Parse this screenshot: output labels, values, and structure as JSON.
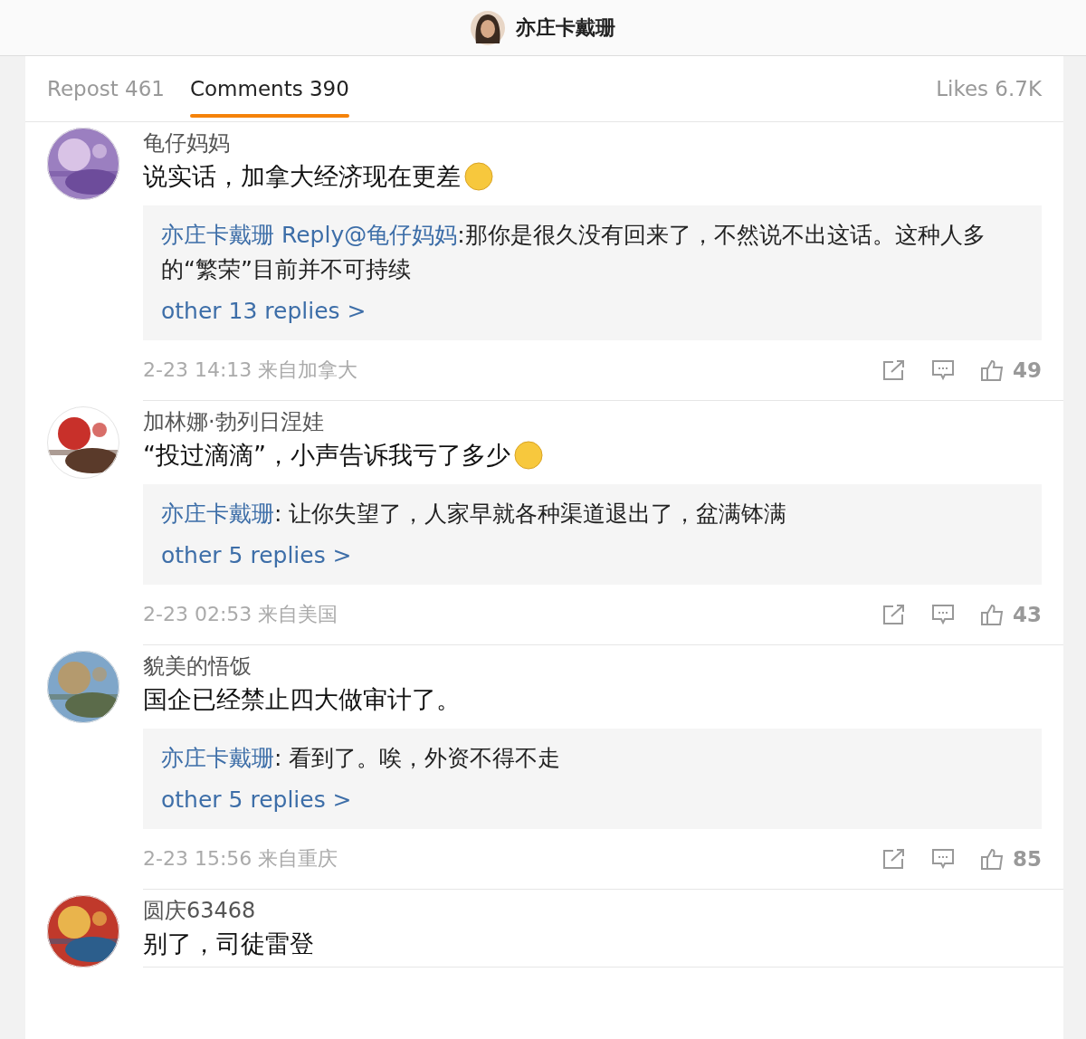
{
  "header": {
    "title": "亦庄卡戴珊"
  },
  "tabs": [
    {
      "label": "Repost 461",
      "selected": false
    },
    {
      "label": "Comments 390",
      "selected": true
    },
    {
      "label": "Likes 6.7K",
      "selected": false
    }
  ],
  "comments": [
    {
      "user": "龟仔妈妈",
      "text": "说实话，加拿大经济现在更差",
      "emoji": true,
      "reply": {
        "author": "亦庄卡戴珊",
        "prefix": "Reply@",
        "target": "龟仔妈妈",
        "text": ":那你是很久没有回来了，不然说不出这话。这种人多的“繁荣”目前并不可持续",
        "more": "other 13 replies >"
      },
      "time": "2-23 14:13 来自加拿大",
      "likes": "49"
    },
    {
      "user": "加林娜·勃列日涅娃",
      "text": "“投过滴滴”，小声告诉我亏了多少",
      "emoji": true,
      "reply": {
        "author": "亦庄卡戴珊",
        "text": ": 让你失望了，人家早就各种渠道退出了，盆满钵满",
        "more": "other 5 replies >"
      },
      "time": "2-23 02:53 来自美国",
      "likes": "43"
    },
    {
      "user": "貌美的悟饭",
      "text": "国企已经禁止四大做审计了。",
      "emoji": false,
      "reply": {
        "author": "亦庄卡戴珊",
        "text": ": 看到了。唉，外资不得不走",
        "more": "other 5 replies >"
      },
      "time": "2-23 15:56 来自重庆",
      "likes": "85"
    },
    {
      "user": "圆庆63468",
      "text": "别了，司徒雷登",
      "emoji": false
    }
  ]
}
